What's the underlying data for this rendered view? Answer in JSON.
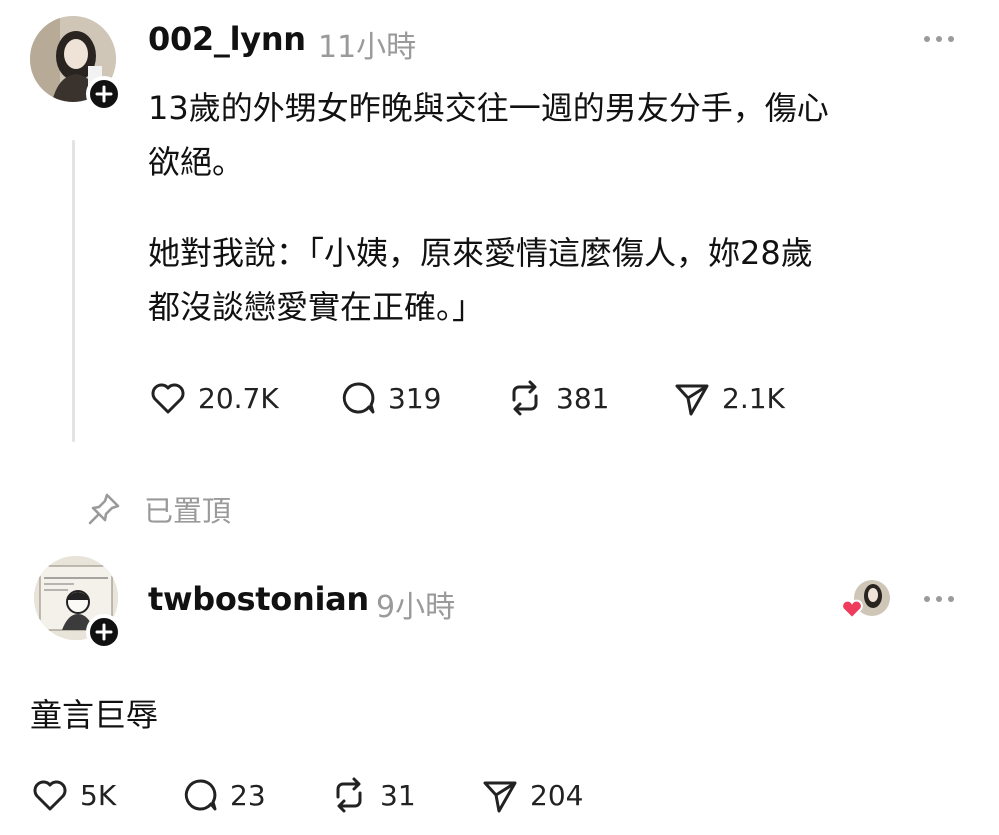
{
  "post": {
    "username": "002_lynn",
    "time": "11小時",
    "lines": [
      "13歲的外甥女昨晚與交往一週的男友分手，傷心",
      "欲絕。",
      "她對我說：「小姨，原來愛情這麼傷人，妳28歲",
      "都沒談戀愛實在正確。」"
    ],
    "stats": {
      "likes": "20.7K",
      "comments": "319",
      "reposts": "381",
      "shares": "2.1K"
    },
    "pinned_label": "已置頂"
  },
  "reply": {
    "username": "twbostonian",
    "time": "9小時",
    "text": "童言巨辱",
    "stats": {
      "likes": "5K",
      "comments": "23",
      "reposts": "31",
      "shares": "204"
    }
  },
  "icons": {
    "like": "heart-icon",
    "comment": "comment-bubble-icon",
    "repost": "repost-icon",
    "share": "send-icon",
    "more": "more-dots-icon",
    "pin": "pin-icon",
    "follow": "plus-icon"
  },
  "colors": {
    "text": "#111111",
    "muted": "#9a9a9a",
    "thread_line": "#e3e3e3",
    "heart_badge": "#ef3b5c"
  }
}
